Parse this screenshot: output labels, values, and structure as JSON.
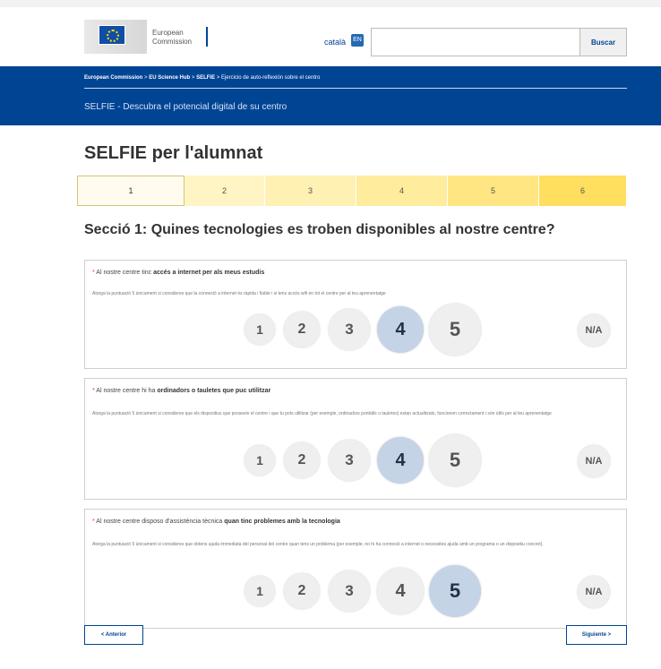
{
  "header": {
    "logo_line1": "European",
    "logo_line2": "Commission",
    "language": "català",
    "language_icon": "EN",
    "search_value": "",
    "search_button": "Buscar"
  },
  "banner": {
    "crumb1": "European Commission",
    "crumb2": "EU Science Hub",
    "crumb3": "SELFIE",
    "crumb4": "Ejercicio de auto-reflexión sobre el centro",
    "separator": ">",
    "site_name": "SELFIE - Descubra el potencial digital de su centro"
  },
  "page": {
    "title": "SELFIE per l'alumnat",
    "section_title": "Secció 1: Quines tecnologies es troben disponibles al nostre centre?"
  },
  "steps": [
    "1",
    "2",
    "3",
    "4",
    "5",
    "6"
  ],
  "questions": [
    {
      "required_mark": "*",
      "prefix": "Al nostre centre tinc ",
      "bold": "accés a internet per als meus estudis",
      "help": "Atorga la puntuació 5 únicament si consideres que la connexió a internet és ràpida i fiable i si tens accés wifi en tot el centre per al teu aprenentatge",
      "options": [
        "1",
        "2",
        "3",
        "4",
        "5"
      ],
      "na": "N/A",
      "selected": "4"
    },
    {
      "required_mark": "*",
      "prefix": "Al nostre centre hi ha ",
      "bold": "ordinadors o tauletes que puc utilitzar",
      "help": "Atorga la puntuació 5 únicament si consideres que els dispositius que posseeix el centre i que tu pots utilitzar (per exemple, ordinadors portàtils o tauletes) estan actualitzats, funcionen correctament i són útils per al teu aprenentatge",
      "options": [
        "1",
        "2",
        "3",
        "4",
        "5"
      ],
      "na": "N/A",
      "selected": "4"
    },
    {
      "required_mark": "*",
      "prefix": "Al nostre centre disposo d'assistència tècnica ",
      "bold": "quan tinc problemes amb la tecnologia",
      "help": "Atorga la puntuació 5 únicament si consideres que obtens ajuda immediata del personal del centre quan tens un problema (per exemple, no hi ha connexió a internet o necessites ajuda amb un programa o un dispositiu concret).",
      "options": [
        "1",
        "2",
        "3",
        "4",
        "5"
      ],
      "na": "N/A",
      "selected": "5"
    }
  ],
  "nav": {
    "prev": "< Anterior",
    "next": "Siguiente >"
  }
}
